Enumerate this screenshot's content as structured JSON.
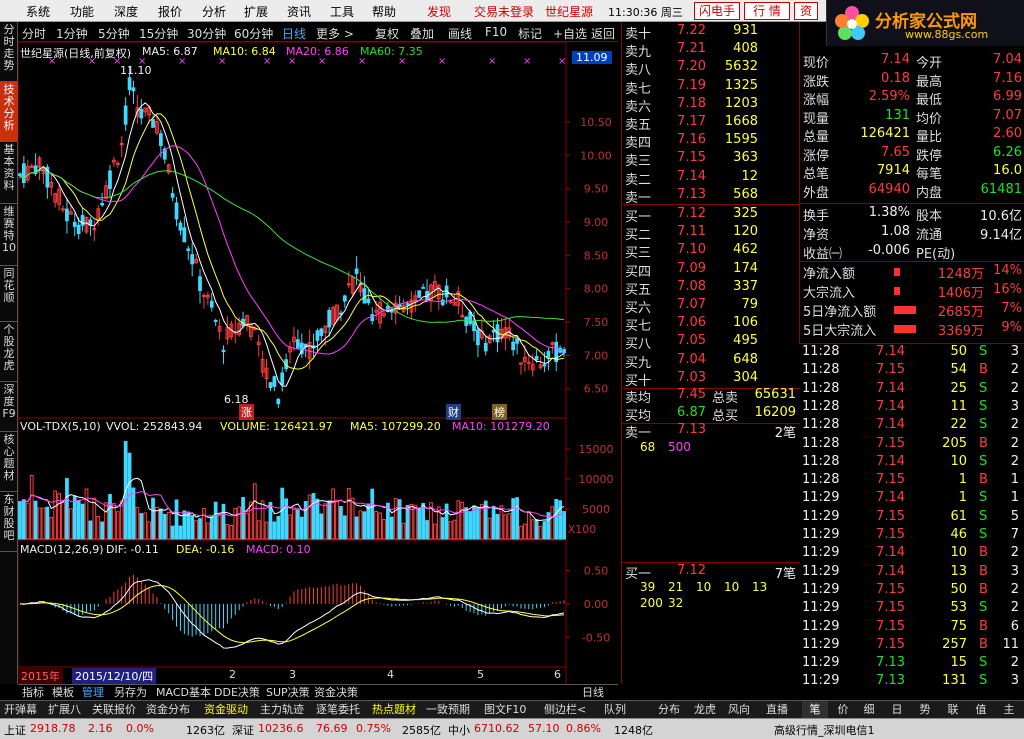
{
  "menu": {
    "items": [
      "系统",
      "功能",
      "深度",
      "报价",
      "分析",
      "扩展",
      "资讯",
      "工具",
      "帮助"
    ],
    "fast": "发现",
    "login": "交易未登录",
    "stock": "世纪星源",
    "time": "11:30:36 周三",
    "btn1": "闪电手",
    "btn2": "行 情",
    "btn3": "资"
  },
  "logo": {
    "title": "分析家公式网",
    "url": "www.88gs.com",
    "code": "000005 世纪星源"
  },
  "leftnav": [
    "分时走势",
    "技术分析",
    "基本资料",
    "维赛特10",
    "同花顺",
    "个股龙虎",
    "深度F9",
    "核心题材",
    "东财股吧"
  ],
  "periods": [
    "分时",
    "1分钟",
    "5分钟",
    "15分钟",
    "30分钟",
    "60分钟",
    "日线",
    "更多 >"
  ],
  "tools": [
    "复权",
    "叠加",
    "画线",
    "F10",
    "标记",
    "+自选",
    "返回"
  ],
  "main_title": "世纪星源(日线,前复权)",
  "ma": {
    "ma5": "MA5: 6.87",
    "ma10": "MA10: 6.84",
    "ma20": "MA20: 6.86",
    "ma60": "MA60: 7.35"
  },
  "vol_title": {
    "name": "VOL-TDX(5,10)",
    "vvol": "VVOL: 252843.94",
    "volume": "VOLUME: 126421.97",
    "ma5": "MA5: 107299.20",
    "ma10": "MA10: 101279.20"
  },
  "macd_title": {
    "name": "MACD(12,26,9)",
    "dif": "DIF: -0.11",
    "dea": "DEA: -0.16",
    "macd": "MACD: 0.10"
  },
  "chart_data": {
    "type": "candlestick",
    "price_axis": [
      "11.09",
      "10.50",
      "10.00",
      "9.50",
      "9.00",
      "8.50",
      "8.00",
      "7.50",
      "7.00",
      "6.50"
    ],
    "price_ylim": [
      6.3,
      11.4
    ],
    "high_label": "11.10",
    "low_label": "6.18",
    "markers": [
      "涨",
      "财",
      "榜"
    ],
    "vol_axis": [
      "15000",
      "10000",
      "5000",
      "X100"
    ],
    "vol_ylim": [
      0,
      17000
    ],
    "macd_axis": [
      "0.50",
      "0.00",
      "-0.50"
    ],
    "macd_ylim": [
      -0.9,
      0.7
    ],
    "x_labels": [
      "2015年",
      "2015/12/10/四",
      "2",
      "3",
      "4",
      "5",
      "6"
    ],
    "ma_lines": [
      "MA5",
      "MA10",
      "MA20",
      "MA60"
    ],
    "colors": {
      "up": "#ff3c3c",
      "down": "#40d8ff",
      "ma5": "#ffffff",
      "ma10": "#ffff40",
      "ma20": "#ff40ff",
      "ma60": "#40e040"
    }
  },
  "asks": [
    [
      "卖十",
      "7.22",
      "931"
    ],
    [
      "卖九",
      "7.21",
      "408"
    ],
    [
      "卖八",
      "7.20",
      "5632"
    ],
    [
      "卖七",
      "7.19",
      "1325"
    ],
    [
      "卖六",
      "7.18",
      "1203"
    ],
    [
      "卖五",
      "7.17",
      "1668"
    ],
    [
      "卖四",
      "7.16",
      "1595"
    ],
    [
      "卖三",
      "7.15",
      "363"
    ],
    [
      "卖二",
      "7.14",
      "12"
    ],
    [
      "卖一",
      "7.13",
      "568"
    ]
  ],
  "bids": [
    [
      "买一",
      "7.12",
      "325"
    ],
    [
      "买二",
      "7.11",
      "120"
    ],
    [
      "买三",
      "7.10",
      "462"
    ],
    [
      "买四",
      "7.09",
      "174"
    ],
    [
      "买五",
      "7.08",
      "337"
    ],
    [
      "买六",
      "7.07",
      "79"
    ],
    [
      "买七",
      "7.06",
      "106"
    ],
    [
      "买八",
      "7.05",
      "495"
    ],
    [
      "买九",
      "7.04",
      "648"
    ],
    [
      "买十",
      "7.03",
      "304"
    ]
  ],
  "avg": {
    "ask_avg_l": "卖均",
    "ask_avg": "7.45",
    "ask_tot_l": "总卖",
    "ask_tot": "65631",
    "bid_avg_l": "买均",
    "bid_avg": "6.87",
    "bid_tot_l": "总买",
    "bid_tot": "16209"
  },
  "queue": {
    "sell_l": "卖一",
    "sell_p": "7.13",
    "sell_n": "2笔",
    "sell_vols": [
      "68",
      "500"
    ],
    "buy_l": "买一",
    "buy_p": "7.12",
    "buy_n": "7笔",
    "buy_vols": [
      "39",
      "21",
      "10",
      "10",
      "13",
      "200",
      "32"
    ]
  },
  "stats": [
    [
      "现价",
      "7.14",
      "今开",
      "7.04"
    ],
    [
      "涨跌",
      "0.18",
      "最高",
      "7.16"
    ],
    [
      "涨幅",
      "2.59%",
      "最低",
      "6.99"
    ],
    [
      "现量",
      "131",
      "均价",
      "7.07"
    ],
    [
      "总量",
      "126421",
      "量比",
      "2.60"
    ],
    [
      "涨停",
      "7.65",
      "跌停",
      "6.26"
    ],
    [
      "总笔",
      "7914",
      "每笔",
      "16.0"
    ],
    [
      "外盘",
      "64940",
      "内盘",
      "61481"
    ]
  ],
  "stats2": [
    [
      "换手",
      "1.38%",
      "股本",
      "10.6亿"
    ],
    [
      "净资",
      "1.08",
      "流通",
      "9.14亿"
    ],
    [
      "收益㈠",
      "-0.006",
      "PE(动)",
      ""
    ]
  ],
  "flows": [
    [
      "净流入额",
      "1248万",
      "14%"
    ],
    [
      "大宗流入",
      "1406万",
      "16%"
    ],
    [
      "5日净流入额",
      "2685万",
      "7%"
    ],
    [
      "5日大宗流入",
      "3369万",
      "9%"
    ]
  ],
  "tick_rows": [
    [
      "11:28",
      "7.14",
      "50",
      "S",
      "3"
    ],
    [
      "11:28",
      "7.15",
      "54",
      "B",
      "2"
    ],
    [
      "11:28",
      "7.14",
      "25",
      "S",
      "2"
    ],
    [
      "11:28",
      "7.14",
      "11",
      "S",
      "3"
    ],
    [
      "11:28",
      "7.14",
      "22",
      "S",
      "2"
    ],
    [
      "11:28",
      "7.15",
      "205",
      "B",
      "2"
    ],
    [
      "11:28",
      "7.14",
      "10",
      "S",
      "2"
    ],
    [
      "11:28",
      "7.15",
      "1",
      "B",
      "1"
    ],
    [
      "11:29",
      "7.14",
      "1",
      "S",
      "1"
    ],
    [
      "11:29",
      "7.15",
      "61",
      "S",
      "5"
    ],
    [
      "11:29",
      "7.15",
      "46",
      "S",
      "7"
    ],
    [
      "11:29",
      "7.14",
      "10",
      "B",
      "2"
    ],
    [
      "11:29",
      "7.14",
      "13",
      "B",
      "3"
    ],
    [
      "11:29",
      "7.15",
      "50",
      "B",
      "2"
    ],
    [
      "11:29",
      "7.15",
      "53",
      "S",
      "2"
    ],
    [
      "11:29",
      "7.15",
      "75",
      "B",
      "6"
    ],
    [
      "11:29",
      "7.15",
      "257",
      "B",
      "11"
    ],
    [
      "11:29",
      "7.13",
      "15",
      "S",
      "2"
    ],
    [
      "11:29",
      "7.13",
      "131",
      "S",
      "3"
    ]
  ],
  "bottom_tabs": [
    "指标",
    "模板",
    "管理",
    "另存为",
    "MACD基本",
    "DDE决策",
    "SUP决策",
    "资金决策"
  ],
  "period_label": "日线",
  "right_tabs": [
    "笔",
    "价",
    "细",
    "日",
    "势",
    "联",
    "值",
    "主"
  ],
  "func": [
    "开弹幕",
    "扩展八",
    "关联报价",
    "资金分布",
    "资金驱动",
    "主力轨迹",
    "逐笔委托",
    "热点题材",
    "一致预期",
    "图文F10",
    "侧边栏<",
    "队列",
    "分布",
    "龙虎",
    "风向",
    "直播"
  ],
  "status": {
    "sh_l": "上证",
    "sh": "2918.78",
    "sh_c": "2.16",
    "sh_p": "0.0%",
    "sh_v": "1263亿",
    "sz_l": "深证",
    "sz": "10236.6",
    "sz_c": "76.69",
    "sz_p": "0.75%",
    "sz_v": "2585亿",
    "zx_l": "中小",
    "zx": "6710.62",
    "zx_c": "57.10",
    "zx_p": "0.86%",
    "zx_v": "1248亿",
    "srv": "高级行情_深圳电信1"
  }
}
